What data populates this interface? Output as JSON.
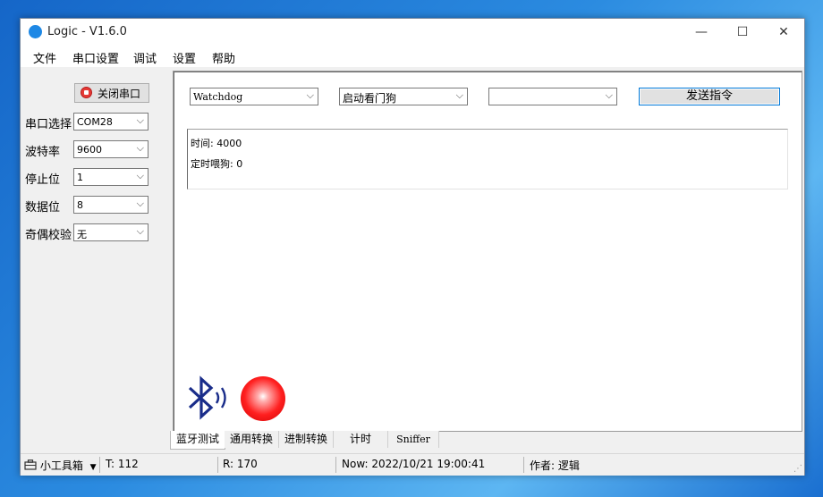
{
  "window": {
    "title": "Logic - V1.6.0",
    "minimize": "—",
    "maximize": "☐",
    "close": "✕"
  },
  "menu": [
    "文件",
    "串口设置",
    "调试",
    "设置",
    "帮助"
  ],
  "left": {
    "close_port_label": "关闭串口",
    "fields": [
      {
        "label": "串口选择",
        "value": "COM28"
      },
      {
        "label": "波特率",
        "value": "9600"
      },
      {
        "label": "停止位",
        "value": "1"
      },
      {
        "label": "数据位",
        "value": "8"
      },
      {
        "label": "奇偶校验",
        "value": "无"
      }
    ]
  },
  "main": {
    "combo1": "Watchdog",
    "combo2": "启动看门狗",
    "combo3": "",
    "send_label": "发送指令",
    "output_lines": [
      "时间: 4000",
      "定时喂狗: 0"
    ]
  },
  "tabs": [
    "蓝牙测试",
    "通用转换",
    "进制转换",
    "计时",
    "Sniffer"
  ],
  "status": {
    "toolbox_label": "小工具箱",
    "t": "T:  112",
    "r": "R:  170",
    "now": "Now:  2022/10/21 19:00:41",
    "author": "作者: 逻辑"
  },
  "colors": {
    "accent": "#0078d7",
    "bluetooth": "#1a2d8a",
    "indicator": "#ff2020"
  }
}
